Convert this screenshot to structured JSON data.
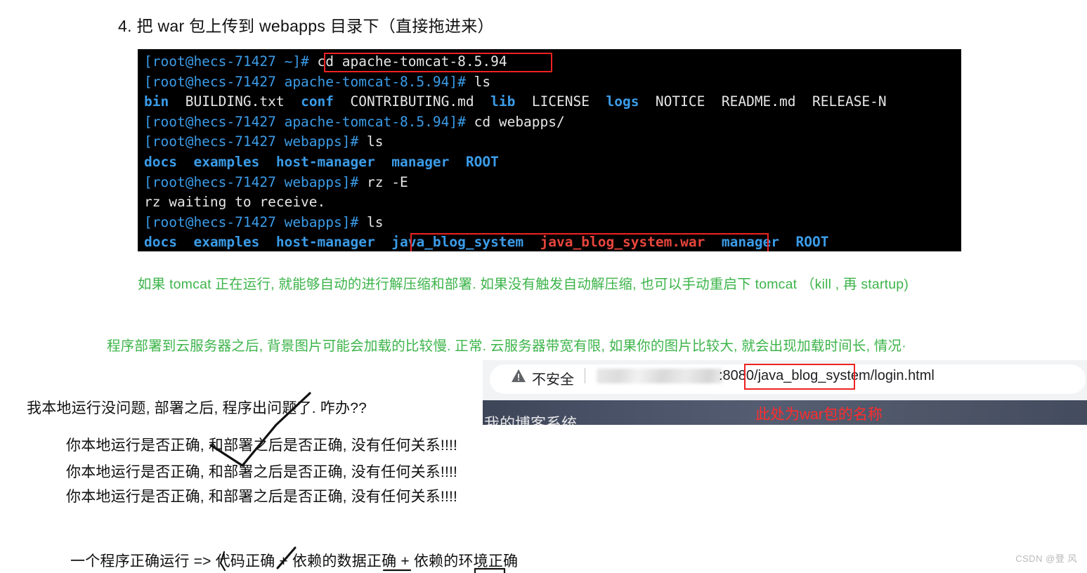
{
  "heading": "4. 把 war 包上传到 webapps 目录下（直接拖进来）",
  "terminal": {
    "lines": [
      [
        {
          "t": "[root@hecs-71427 ~]#",
          "c": "prompt"
        },
        {
          "t": " cd apache-tomcat-8.5.94",
          "c": "white"
        }
      ],
      [
        {
          "t": "[root@hecs-71427 apache-tomcat-8.5.94]#",
          "c": "prompt"
        },
        {
          "t": " ls",
          "c": "white"
        }
      ],
      [
        {
          "t": "bin",
          "c": "dir"
        },
        {
          "t": "  BUILDING.txt  ",
          "c": "white"
        },
        {
          "t": "conf",
          "c": "dir"
        },
        {
          "t": "  CONTRIBUTING.md  ",
          "c": "white"
        },
        {
          "t": "lib",
          "c": "dir"
        },
        {
          "t": "  LICENSE  ",
          "c": "white"
        },
        {
          "t": "logs",
          "c": "dir"
        },
        {
          "t": "  NOTICE  README.md  RELEASE-N",
          "c": "white"
        }
      ],
      [
        {
          "t": "[root@hecs-71427 apache-tomcat-8.5.94]#",
          "c": "prompt"
        },
        {
          "t": " cd webapps/",
          "c": "white"
        }
      ],
      [
        {
          "t": "[root@hecs-71427 webapps]#",
          "c": "prompt"
        },
        {
          "t": " ls",
          "c": "white"
        }
      ],
      [
        {
          "t": "docs",
          "c": "dir"
        },
        {
          "t": "  ",
          "c": "white"
        },
        {
          "t": "examples",
          "c": "dir"
        },
        {
          "t": "  ",
          "c": "white"
        },
        {
          "t": "host-manager",
          "c": "dir"
        },
        {
          "t": "  ",
          "c": "white"
        },
        {
          "t": "manager",
          "c": "dir"
        },
        {
          "t": "  ",
          "c": "white"
        },
        {
          "t": "ROOT",
          "c": "dir"
        }
      ],
      [
        {
          "t": "[root@hecs-71427 webapps]#",
          "c": "prompt"
        },
        {
          "t": " rz -E",
          "c": "white"
        }
      ],
      [
        {
          "t": "rz waiting to receive.",
          "c": "white"
        }
      ],
      [
        {
          "t": "[root@hecs-71427 webapps]#",
          "c": "prompt"
        },
        {
          "t": " ls",
          "c": "white"
        }
      ],
      [
        {
          "t": "docs",
          "c": "dir"
        },
        {
          "t": "  ",
          "c": "white"
        },
        {
          "t": "examples",
          "c": "dir"
        },
        {
          "t": "  ",
          "c": "white"
        },
        {
          "t": "host-manager",
          "c": "dir"
        },
        {
          "t": "  ",
          "c": "white"
        },
        {
          "t": "java_blog_system",
          "c": "dir"
        },
        {
          "t": "  ",
          "c": "white"
        },
        {
          "t": "java_blog_system.war",
          "c": "arch"
        },
        {
          "t": "  ",
          "c": "white"
        },
        {
          "t": "manager",
          "c": "dir"
        },
        {
          "t": "  ",
          "c": "white"
        },
        {
          "t": "ROOT",
          "c": "dir"
        }
      ]
    ]
  },
  "notes": {
    "green_1": "如果 tomcat 正在运行, 就能够自动的进行解压缩和部署. 如果没有触发自动解压缩, 也可以手动重启下 tomcat （kill , 再 startup)",
    "green_2": "程序部署到云服务器之后, 背景图片可能会加载的比较慢. 正常. 云服务器带宽有限, 如果你的图片比较大, 就会出现加载时间长, 情况·"
  },
  "browser": {
    "security_label": "不安全",
    "url_text": ":8080/java_blog_system/login.html",
    "banner_title": "我的博客系统",
    "annotation": "此处为war包的名称"
  },
  "body": {
    "question": "我本地运行没问题, 部署之后, 程序出问题了. 咋办??",
    "answer_line": "你本地运行是否正确, 和部署之后是否正确, 没有任何关系!!!!",
    "formula": "一个程序正确运行 => 代码正确 + 依赖的数据正确 + 依赖的环境正确"
  },
  "watermark": "CSDN @登 风",
  "colors": {
    "terminal_bg": "#000000",
    "prompt_blue": "#3b9ce8",
    "dir_blue": "#3b9ce8",
    "archive_red": "#e8453c",
    "callout_red": "#ee2222",
    "note_green": "#3cb44a",
    "annotation_red": "#ff2d2d"
  }
}
